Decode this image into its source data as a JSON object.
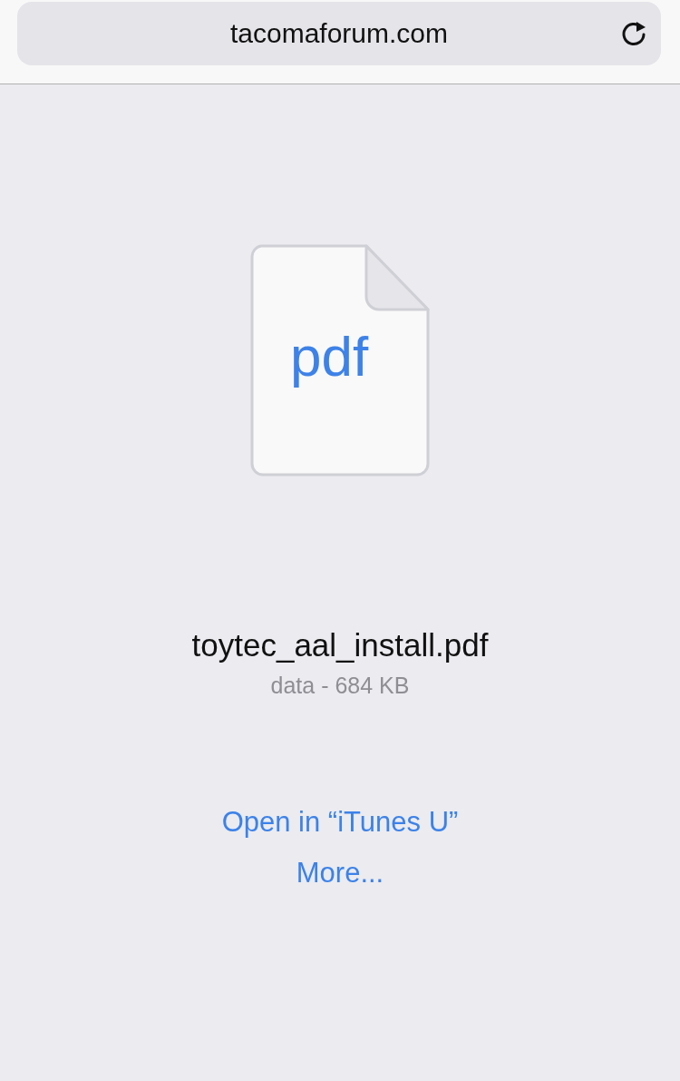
{
  "address_bar": {
    "url": "tacomaforum.com"
  },
  "file": {
    "icon_label": "pdf",
    "name": "toytec_aal_install.pdf",
    "details": "data - 684 KB"
  },
  "actions": [
    {
      "label": "Open in “iTunes U”"
    },
    {
      "label": "More..."
    }
  ]
}
